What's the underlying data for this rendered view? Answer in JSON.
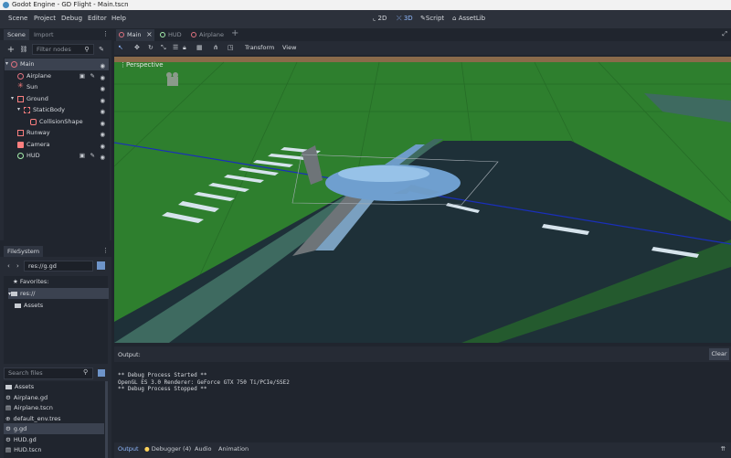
{
  "window": {
    "title": "Godot Engine - GD Flight - Main.tscn"
  },
  "menu": [
    "Scene",
    "Project",
    "Debug",
    "Editor",
    "Help"
  ],
  "workspaces": {
    "w2d": "2D",
    "w3d": "3D",
    "script": "Script",
    "assetlib": "AssetLib"
  },
  "scene_dock": {
    "tabs": [
      "Scene",
      "Import"
    ],
    "filter_placeholder": "Filter nodes",
    "nodes": [
      {
        "label": "Main",
        "color": "#e0727f"
      },
      {
        "label": "Airplane",
        "color": "#e0727f"
      },
      {
        "label": "Sun",
        "color": "#fc7f7f"
      },
      {
        "label": "Ground",
        "color": "#fc7f7f"
      },
      {
        "label": "StaticBody",
        "color": "#fc7f7f"
      },
      {
        "label": "CollisionShape",
        "color": "#fc7f7f"
      },
      {
        "label": "Runway",
        "color": "#fc7f7f"
      },
      {
        "label": "Camera",
        "color": "#fc7f7f"
      },
      {
        "label": "HUD",
        "color": "#a5efac"
      }
    ]
  },
  "filesystem": {
    "tab": "FileSystem",
    "path": "res://g.gd",
    "favorites": "Favorites:",
    "root": "res://",
    "assets": "Assets",
    "search_placeholder": "Search files",
    "files": [
      "Assets",
      "Airplane.gd",
      "Airplane.tscn",
      "default_env.tres",
      "g.gd",
      "HUD.gd",
      "HUD.tscn"
    ]
  },
  "scene_tabs": [
    "Main",
    "HUD",
    "Airplane"
  ],
  "viewport_toolbar": {
    "transform": "Transform",
    "view": "View"
  },
  "viewport": {
    "label": "Perspective"
  },
  "output": {
    "title": "Output:",
    "clear": "Clear",
    "lines": [
      "** Debug Process Started **",
      "OpenGL ES 3.0 Renderer: GeForce GTX 750 Ti/PCIe/SSE2",
      "** Debug Process Stopped **"
    ]
  },
  "bottom_tabs": {
    "output": "Output",
    "debugger": "Debugger (4)",
    "audio": "Audio",
    "animation": "Animation"
  }
}
